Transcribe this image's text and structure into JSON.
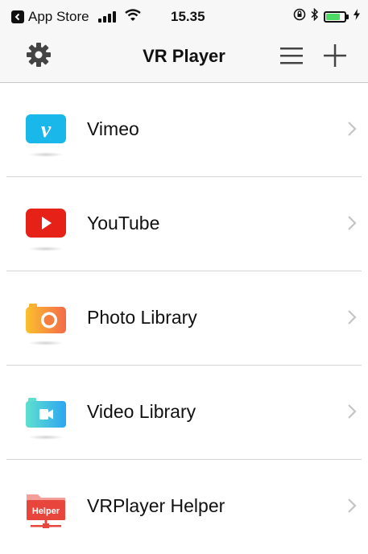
{
  "status_bar": {
    "back_app": "App Store",
    "time": "15.35"
  },
  "nav": {
    "title": "VR Player",
    "icons": {
      "settings": "gear-icon",
      "menu": "menu-icon",
      "add": "plus-icon"
    }
  },
  "sources": [
    {
      "label": "Vimeo",
      "icon": "vimeo-icon",
      "color": "#1ab7ea"
    },
    {
      "label": "YouTube",
      "icon": "youtube-icon",
      "color": "#e62117"
    },
    {
      "label": "Photo Library",
      "icon": "camera-icon",
      "color": "#f5a623"
    },
    {
      "label": "Video Library",
      "icon": "video-camera-icon",
      "color": "#3fc6e9"
    },
    {
      "label": "VRPlayer Helper",
      "icon": "helper-folder-icon",
      "color": "#e8463c",
      "badge": "Helper"
    }
  ]
}
